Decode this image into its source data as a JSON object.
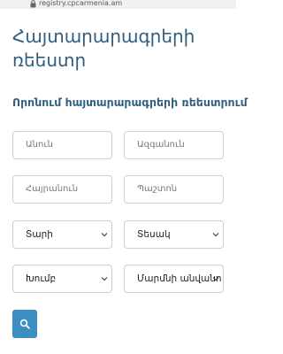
{
  "browser": {
    "url": "registry.cpcarmenia.am",
    "lock_icon": "lock-icon"
  },
  "page": {
    "title": "Հայտարարագրերի ռեեստր",
    "section_title": "Որոնում հայտարարագրերի ռեեստրում"
  },
  "form": {
    "first_name_placeholder": "Անուն",
    "last_name_placeholder": "Ազգանուն",
    "patronymic_placeholder": "Հայրանուն",
    "position_placeholder": "Պաշտոն",
    "year_label": "Տարի",
    "type_label": "Տեսակ",
    "group_label": "Խումբ",
    "body_name_label": "Մարմնի անվանո",
    "search_icon": "search-icon"
  },
  "colors": {
    "title": "#2f5f80",
    "button": "#3b8fc0"
  }
}
